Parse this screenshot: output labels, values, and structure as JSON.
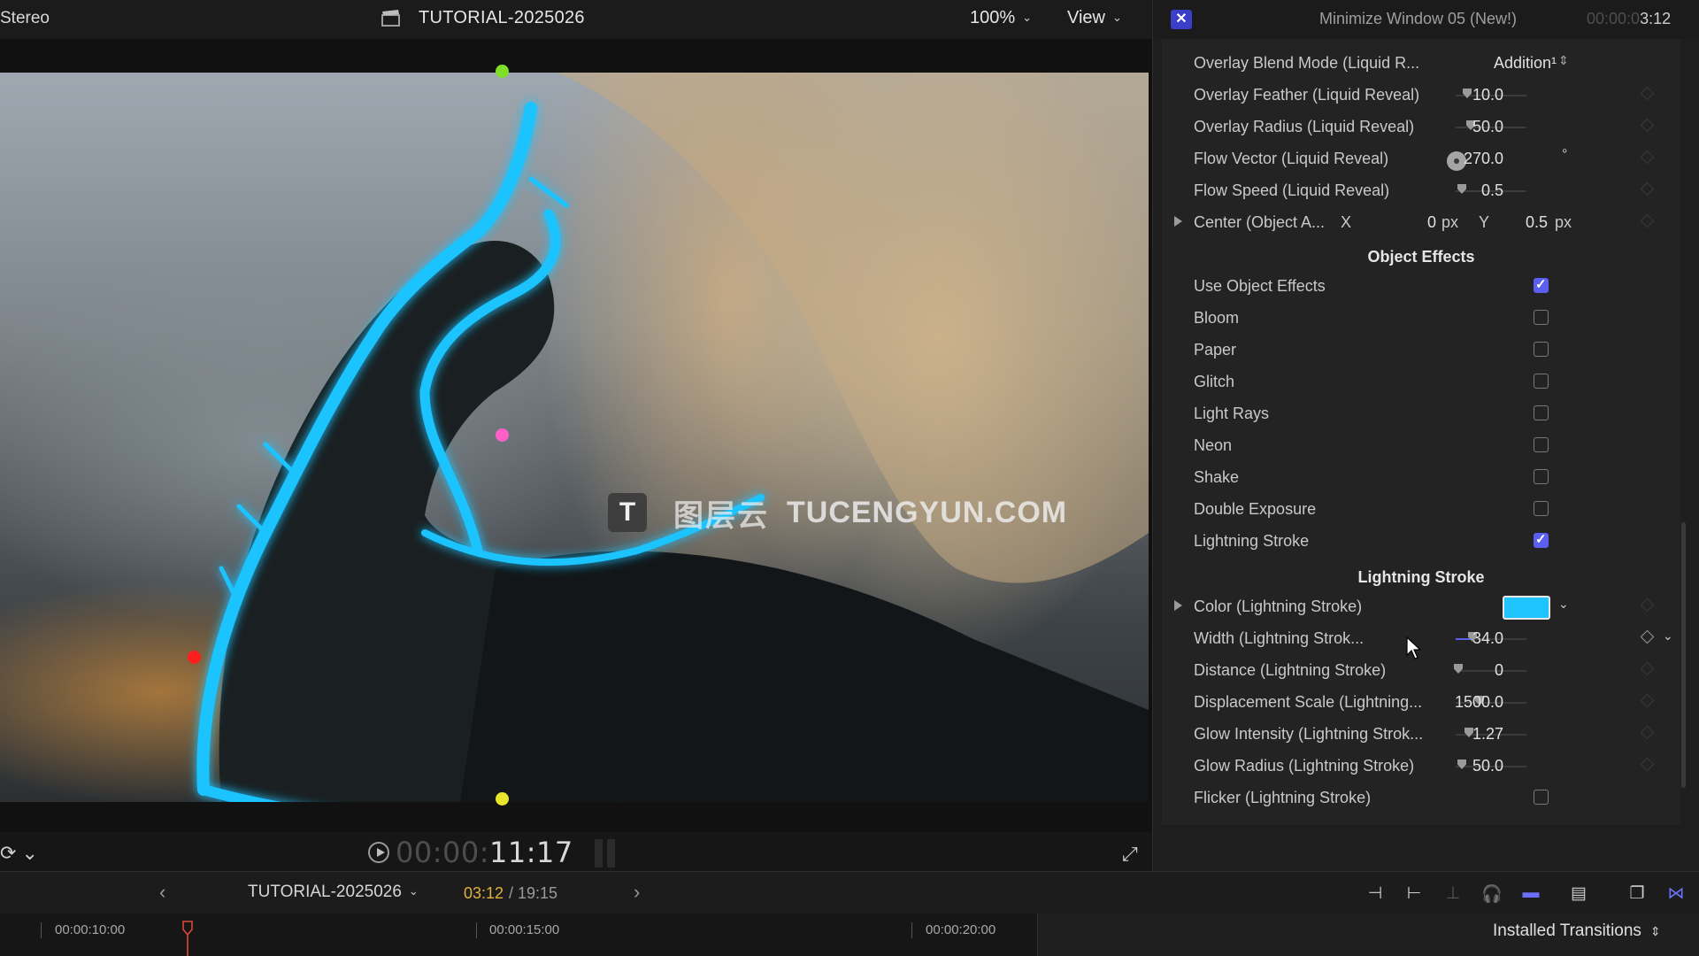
{
  "viewer": {
    "audio_label": "Stereo",
    "project_title": "TUTORIAL-2025026",
    "zoom": "100%",
    "view_menu": "View",
    "watermark_cn": "图层云",
    "watermark_text": "TUCENGYUN.COM",
    "watermark_logo": "T",
    "timecode_dim": "00:00:",
    "timecode_bright": "11:17"
  },
  "inspector": {
    "title": "Minimize Window 05 (New!)",
    "time_dim": "00:00:0",
    "time_bright": "3:12",
    "rows": {
      "blend_mode": {
        "label": "Overlay Blend Mode (Liquid R...",
        "value": "Addition¹"
      },
      "feather": {
        "label": "Overlay Feather (Liquid Reveal)",
        "value": "10.0"
      },
      "radius": {
        "label": "Overlay Radius (Liquid Reveal)",
        "value": "50.0"
      },
      "flow_vector": {
        "label": "Flow Vector (Liquid Reveal)",
        "value": "270.0",
        "unit": "°"
      },
      "flow_speed": {
        "label": "Flow Speed (Liquid Reveal)",
        "value": "0.5"
      },
      "center": {
        "label": "Center (Object A...",
        "x_label": "X",
        "x_value": "0",
        "x_unit": "px",
        "y_label": "Y",
        "y_value": "0.5",
        "y_unit": "px"
      }
    },
    "object_effects_title": "Object Effects",
    "checkboxes": [
      {
        "label": "Use Object Effects",
        "checked": true
      },
      {
        "label": "Bloom",
        "checked": false
      },
      {
        "label": "Paper",
        "checked": false
      },
      {
        "label": "Glitch",
        "checked": false
      },
      {
        "label": "Light Rays",
        "checked": false
      },
      {
        "label": "Neon",
        "checked": false
      },
      {
        "label": "Shake",
        "checked": false
      },
      {
        "label": "Double Exposure",
        "checked": false
      },
      {
        "label": "Lightning Stroke",
        "checked": true
      }
    ],
    "lightning_title": "Lightning Stroke",
    "lightning": {
      "color_label": "Color (Lightning Stroke)",
      "color_value": "#1fc4ff",
      "width": {
        "label": "Width (Lightning Strok...",
        "value": "34.0"
      },
      "distance": {
        "label": "Distance (Lightning Stroke)",
        "value": "0"
      },
      "displacement": {
        "label": "Displacement Scale (Lightning...",
        "value": "1500.0"
      },
      "glow_intensity": {
        "label": "Glow Intensity (Lightning Strok...",
        "value": "1.27"
      },
      "glow_radius": {
        "label": "Glow Radius (Lightning Stroke)",
        "value": "50.0"
      },
      "flicker_label": "Flicker (Lightning Stroke)"
    }
  },
  "timeline": {
    "project": "TUTORIAL-2025026",
    "current": "03:12",
    "total": "/ 19:15",
    "ruler_labels": [
      "00:00:10:00",
      "00:00:15:00",
      "00:00:20:00"
    ],
    "transitions_label": "Installed Transitions"
  },
  "colors": {
    "accent": "#5a5ff0",
    "stroke_cyan": "#1fc4ff",
    "timecode_orange": "#e3b13a",
    "playhead_red": "#e2463a"
  }
}
